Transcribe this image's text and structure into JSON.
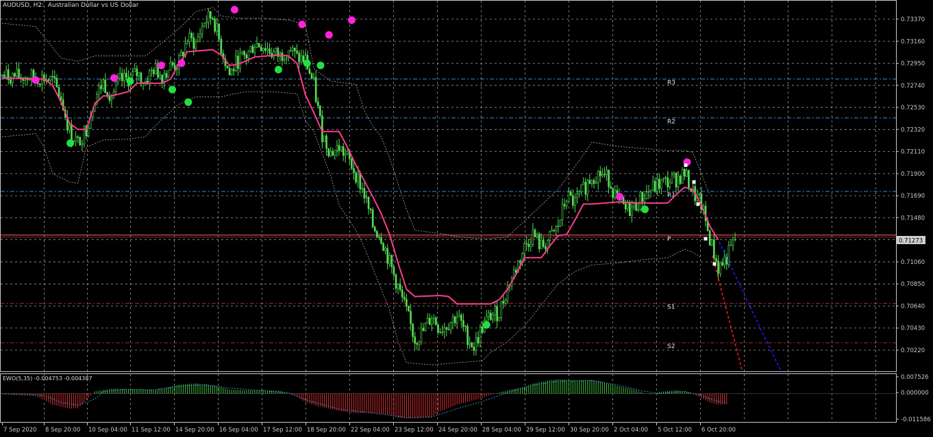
{
  "window": {
    "symbol": "AUDUSD",
    "timeframe": "H2",
    "description": "Australian Dollar vs US Dollar"
  },
  "price_tag": "0.71273",
  "colors": {
    "background": "#000000",
    "grid": "#d0d0d0",
    "candle": "#55e055",
    "mid_line": "#ff3c8c",
    "envelope": "#b0b0b0",
    "pivot_line": "#3a8fd8",
    "support_line": "#b02828",
    "pivot_p_line": "#ff6a6a",
    "upper_dot": "#ff22dd",
    "lower_dot": "#22e044",
    "forecast_red": "#ff2020",
    "forecast_blue": "#2020ff",
    "ewo_up": "#40c040",
    "ewo_down": "#d83030",
    "ewo_signal": "#3a8fd8"
  },
  "pivots": [
    {
      "label": "R3",
      "price": 0.728
    },
    {
      "label": "R2",
      "price": 0.7243
    },
    {
      "label": "R1",
      "price": 0.7173
    },
    {
      "label": "P",
      "price": 0.71315
    },
    {
      "label": "S1",
      "price": 0.70665
    },
    {
      "label": "S2",
      "price": 0.7029
    }
  ],
  "indicator": {
    "name": "EWO(5,35)",
    "value1": "-0.004753",
    "value2": "-0.004387",
    "y_ticks": [
      "0.007526",
      "0.000000",
      "-0.011586"
    ]
  },
  "chart_data": {
    "type": "candlestick",
    "symbol": "AUDUSD",
    "timeframe": "H2",
    "x_ticks": [
      "7 Sep 2020",
      "8 Sep 20:00",
      "10 Sep 04:00",
      "11 Sep 12:00",
      "14 Sep 20:00",
      "16 Sep 04:00",
      "17 Sep 12:00",
      "18 Sep 20:00",
      "22 Sep 04:00",
      "23 Sep 12:00",
      "24 Sep 20:00",
      "28 Sep 04:00",
      "29 Sep 12:00",
      "30 Sep 20:00",
      "2 Oct 04:00",
      "5 Oct 12:00",
      "6 Oct 20:00"
    ],
    "y_ticks": [
      "0.73370",
      "0.73160",
      "0.72950",
      "0.72740",
      "0.72530",
      "0.72320",
      "0.72110",
      "0.71900",
      "0.71690",
      "0.71480",
      "0.71273",
      "0.71060",
      "0.70850",
      "0.70640",
      "0.70430",
      "0.70220"
    ],
    "ylim": [
      0.701,
      0.735
    ],
    "close_path": [
      [
        0,
        0.7283
      ],
      [
        3,
        0.7282
      ],
      [
        5,
        0.7281
      ],
      [
        6,
        0.7278
      ],
      [
        7,
        0.7262
      ],
      [
        8,
        0.723
      ],
      [
        9,
        0.7219
      ],
      [
        10,
        0.7233
      ],
      [
        11,
        0.7262
      ],
      [
        12,
        0.7277
      ],
      [
        13,
        0.7264
      ],
      [
        14,
        0.7278
      ],
      [
        15,
        0.728
      ],
      [
        16,
        0.7285
      ],
      [
        17,
        0.7278
      ],
      [
        18,
        0.729
      ],
      [
        19,
        0.7284
      ],
      [
        20,
        0.7292
      ],
      [
        21,
        0.7295
      ],
      [
        22,
        0.7318
      ],
      [
        23,
        0.7314
      ],
      [
        24,
        0.7335
      ],
      [
        25,
        0.734
      ],
      [
        26,
        0.731
      ],
      [
        27,
        0.7284
      ],
      [
        28,
        0.7298
      ],
      [
        29,
        0.7302
      ],
      [
        30,
        0.7314
      ],
      [
        31,
        0.7312
      ],
      [
        32,
        0.7305
      ],
      [
        33,
        0.7302
      ],
      [
        34,
        0.731
      ],
      [
        35,
        0.73
      ],
      [
        36,
        0.7298
      ],
      [
        37,
        0.7274
      ],
      [
        38,
        0.7228
      ],
      [
        39,
        0.721
      ],
      [
        40,
        0.7215
      ],
      [
        41,
        0.7205
      ],
      [
        42,
        0.719
      ],
      [
        43,
        0.717
      ],
      [
        44,
        0.714
      ],
      [
        45,
        0.713
      ],
      [
        46,
        0.7105
      ],
      [
        47,
        0.7082
      ],
      [
        48,
        0.7058
      ],
      [
        49,
        0.7032
      ],
      [
        50,
        0.704
      ],
      [
        51,
        0.7055
      ],
      [
        52,
        0.7042
      ],
      [
        53,
        0.7048
      ],
      [
        54,
        0.7055
      ],
      [
        55,
        0.7038
      ],
      [
        56,
        0.7025
      ],
      [
        57,
        0.7044
      ],
      [
        58,
        0.7055
      ],
      [
        59,
        0.7058
      ],
      [
        60,
        0.7082
      ],
      [
        61,
        0.71
      ],
      [
        62,
        0.712
      ],
      [
        63,
        0.7133
      ],
      [
        64,
        0.712
      ],
      [
        65,
        0.7128
      ],
      [
        66,
        0.714
      ],
      [
        67,
        0.7168
      ],
      [
        68,
        0.7162
      ],
      [
        69,
        0.7175
      ],
      [
        70,
        0.7188
      ],
      [
        71,
        0.719
      ],
      [
        72,
        0.7185
      ],
      [
        73,
        0.7165
      ],
      [
        74,
        0.7155
      ],
      [
        75,
        0.7158
      ],
      [
        76,
        0.7168
      ],
      [
        77,
        0.7175
      ],
      [
        78,
        0.718
      ],
      [
        79,
        0.7182
      ],
      [
        80,
        0.7185
      ],
      [
        81,
        0.719
      ],
      [
        82,
        0.7172
      ],
      [
        83,
        0.716
      ],
      [
        84,
        0.7128
      ],
      [
        85,
        0.71
      ],
      [
        86,
        0.711
      ],
      [
        87,
        0.7127
      ]
    ],
    "mid_line": [
      [
        0,
        0.7281
      ],
      [
        5,
        0.728
      ],
      [
        6,
        0.7274
      ],
      [
        7,
        0.7258
      ],
      [
        8,
        0.7238
      ],
      [
        9,
        0.7232
      ],
      [
        10,
        0.7232
      ],
      [
        11,
        0.7256
      ],
      [
        12,
        0.7264
      ],
      [
        13,
        0.7264
      ],
      [
        15,
        0.7268
      ],
      [
        16,
        0.7276
      ],
      [
        18,
        0.7276
      ],
      [
        19,
        0.7276
      ],
      [
        20,
        0.728
      ],
      [
        21,
        0.7295
      ],
      [
        22,
        0.7306
      ],
      [
        25,
        0.7308
      ],
      [
        26,
        0.7303
      ],
      [
        27,
        0.7293
      ],
      [
        28,
        0.7294
      ],
      [
        30,
        0.7301
      ],
      [
        33,
        0.7303
      ],
      [
        34,
        0.7302
      ],
      [
        35,
        0.7295
      ],
      [
        36,
        0.7265
      ],
      [
        37,
        0.7248
      ],
      [
        38,
        0.723
      ],
      [
        40,
        0.723
      ],
      [
        41,
        0.7215
      ],
      [
        42,
        0.7198
      ],
      [
        43,
        0.7183
      ],
      [
        44,
        0.7168
      ],
      [
        45,
        0.7152
      ],
      [
        46,
        0.7132
      ],
      [
        47,
        0.7105
      ],
      [
        48,
        0.708
      ],
      [
        49,
        0.7073
      ],
      [
        52,
        0.7074
      ],
      [
        53,
        0.7073
      ],
      [
        54,
        0.7066
      ],
      [
        57,
        0.7066
      ],
      [
        58,
        0.7066
      ],
      [
        59,
        0.707
      ],
      [
        60,
        0.708
      ],
      [
        61,
        0.7094
      ],
      [
        62,
        0.711
      ],
      [
        63,
        0.711
      ],
      [
        64,
        0.711
      ],
      [
        65,
        0.7121
      ],
      [
        66,
        0.7131
      ],
      [
        67,
        0.7132
      ],
      [
        68,
        0.7146
      ],
      [
        69,
        0.7161
      ],
      [
        70,
        0.7161
      ],
      [
        73,
        0.7163
      ],
      [
        76,
        0.7162
      ],
      [
        79,
        0.7162
      ],
      [
        80,
        0.717
      ],
      [
        81,
        0.7177
      ],
      [
        82,
        0.7175
      ],
      [
        83,
        0.716
      ],
      [
        84,
        0.714
      ],
      [
        85,
        0.7127
      ]
    ],
    "envelope_upper": [
      [
        0,
        0.7333
      ],
      [
        4,
        0.733
      ],
      [
        5,
        0.732
      ],
      [
        7,
        0.73
      ],
      [
        9,
        0.7297
      ],
      [
        11,
        0.7302
      ],
      [
        14,
        0.7302
      ],
      [
        17,
        0.7302
      ],
      [
        18,
        0.7308
      ],
      [
        21,
        0.7328
      ],
      [
        23,
        0.7344
      ],
      [
        25,
        0.7348
      ],
      [
        26,
        0.734
      ],
      [
        28,
        0.7338
      ],
      [
        31,
        0.7338
      ],
      [
        34,
        0.7336
      ],
      [
        36,
        0.7332
      ],
      [
        37,
        0.729
      ],
      [
        39,
        0.7278
      ],
      [
        42,
        0.7275
      ],
      [
        43,
        0.725
      ],
      [
        44,
        0.7235
      ],
      [
        45,
        0.7225
      ],
      [
        46,
        0.7205
      ],
      [
        47,
        0.718
      ],
      [
        48,
        0.7156
      ],
      [
        49,
        0.7136
      ],
      [
        52,
        0.7133
      ],
      [
        54,
        0.713
      ],
      [
        57,
        0.7128
      ],
      [
        58,
        0.7128
      ],
      [
        60,
        0.713
      ],
      [
        62,
        0.7145
      ],
      [
        64,
        0.716
      ],
      [
        66,
        0.7175
      ],
      [
        67,
        0.7186
      ],
      [
        69,
        0.7208
      ],
      [
        70,
        0.722
      ],
      [
        73,
        0.7216
      ],
      [
        76,
        0.7214
      ],
      [
        79,
        0.7212
      ],
      [
        81,
        0.7212
      ],
      [
        82,
        0.721
      ],
      [
        83,
        0.719
      ],
      [
        84,
        0.717
      ]
    ],
    "envelope_lower": [
      [
        0,
        0.7225
      ],
      [
        4,
        0.7228
      ],
      [
        5,
        0.7215
      ],
      [
        6,
        0.719
      ],
      [
        8,
        0.7182
      ],
      [
        9,
        0.7181
      ],
      [
        10,
        0.7215
      ],
      [
        12,
        0.7222
      ],
      [
        15,
        0.7223
      ],
      [
        17,
        0.7225
      ],
      [
        18,
        0.7234
      ],
      [
        19,
        0.7242
      ],
      [
        21,
        0.7256
      ],
      [
        23,
        0.7263
      ],
      [
        26,
        0.7263
      ],
      [
        27,
        0.7265
      ],
      [
        29,
        0.7268
      ],
      [
        32,
        0.7268
      ],
      [
        35,
        0.7266
      ],
      [
        36,
        0.724
      ],
      [
        37,
        0.723
      ],
      [
        39,
        0.7188
      ],
      [
        40,
        0.716
      ],
      [
        42,
        0.7136
      ],
      [
        43,
        0.712
      ],
      [
        44,
        0.71
      ],
      [
        45,
        0.708
      ],
      [
        46,
        0.706
      ],
      [
        47,
        0.703
      ],
      [
        48,
        0.701
      ],
      [
        51,
        0.7008
      ],
      [
        54,
        0.701
      ],
      [
        57,
        0.7012
      ],
      [
        58,
        0.702
      ],
      [
        60,
        0.703
      ],
      [
        62,
        0.7045
      ],
      [
        64,
        0.7065
      ],
      [
        66,
        0.7085
      ],
      [
        68,
        0.7097
      ],
      [
        70,
        0.7103
      ],
      [
        73,
        0.7105
      ],
      [
        76,
        0.7108
      ],
      [
        79,
        0.711
      ],
      [
        81,
        0.7118
      ],
      [
        82,
        0.7115
      ],
      [
        83,
        0.711
      ]
    ],
    "upper_dots": [
      [
        1,
        0.7279
      ],
      [
        5,
        0.728
      ],
      [
        6,
        0.7279
      ],
      [
        9,
        0.7292
      ],
      [
        10,
        0.7294
      ],
      [
        11,
        0.7341
      ],
      [
        12,
        0.732
      ],
      [
        13,
        0.7311
      ],
      [
        14,
        0.7328
      ],
      [
        22,
        0.7168
      ],
      [
        26,
        0.7204
      ]
    ],
    "lower_dots": [
      [
        3,
        0.7218
      ],
      [
        4,
        0.728
      ],
      [
        6,
        0.727
      ],
      [
        7,
        0.726
      ],
      [
        8,
        0.7289
      ],
      [
        9,
        0.7294
      ],
      [
        10,
        0.7292
      ],
      [
        18,
        0.7046
      ],
      [
        23,
        0.7159
      ]
    ],
    "forecast_red": [
      [
        84,
        0.7113
      ],
      [
        88,
        0.7005
      ]
    ],
    "forecast_blue": [
      [
        85,
        0.7125
      ],
      [
        91,
        0.7005
      ]
    ],
    "ewo": [
      [
        0,
        -0.0002
      ],
      [
        4,
        -0.001
      ],
      [
        6,
        -0.005
      ],
      [
        8,
        -0.0068
      ],
      [
        9,
        -0.0066
      ],
      [
        10,
        -0.003
      ],
      [
        11,
        0.001
      ],
      [
        13,
        0.0022
      ],
      [
        16,
        0.002
      ],
      [
        18,
        0.0018
      ],
      [
        19,
        0.0023
      ],
      [
        21,
        0.004
      ],
      [
        23,
        0.0046
      ],
      [
        25,
        0.0038
      ],
      [
        27,
        0.0018
      ],
      [
        29,
        0.0015
      ],
      [
        31,
        0.0016
      ],
      [
        33,
        0.0012
      ],
      [
        35,
        -0.0012
      ],
      [
        36,
        -0.004
      ],
      [
        38,
        -0.0062
      ],
      [
        40,
        -0.0078
      ],
      [
        42,
        -0.0089
      ],
      [
        44,
        -0.0088
      ],
      [
        46,
        -0.0095
      ],
      [
        47,
        -0.011
      ],
      [
        48,
        -0.0112
      ],
      [
        49,
        -0.0112
      ],
      [
        51,
        -0.0105
      ],
      [
        52,
        -0.008
      ],
      [
        54,
        -0.005
      ],
      [
        55,
        -0.004
      ],
      [
        57,
        -0.002
      ],
      [
        58,
        -0.0006
      ],
      [
        60,
        0.0015
      ],
      [
        62,
        0.003
      ],
      [
        63,
        0.0045
      ],
      [
        65,
        0.006
      ],
      [
        66,
        0.0065
      ],
      [
        68,
        0.006
      ],
      [
        70,
        0.0062
      ],
      [
        71,
        0.0055
      ],
      [
        73,
        0.0035
      ],
      [
        75,
        0.0018
      ],
      [
        76,
        0.0005
      ],
      [
        77,
        -0.0006
      ],
      [
        78,
        0.0008
      ],
      [
        80,
        0.0015
      ],
      [
        81,
        0.001
      ],
      [
        82,
        0.0002
      ],
      [
        83,
        -0.002
      ],
      [
        84,
        -0.004
      ],
      [
        85,
        -0.005
      ],
      [
        86,
        -0.0048
      ]
    ],
    "ewo_signal": [
      [
        0,
        -0.0001
      ],
      [
        5,
        -0.0008
      ],
      [
        7,
        -0.004
      ],
      [
        9,
        -0.0052
      ],
      [
        11,
        -0.0025
      ],
      [
        12,
        0.0008
      ],
      [
        14,
        0.0018
      ],
      [
        18,
        0.0017
      ],
      [
        21,
        0.0033
      ],
      [
        24,
        0.004
      ],
      [
        27,
        0.0025
      ],
      [
        30,
        0.0016
      ],
      [
        34,
        0.0004
      ],
      [
        36,
        -0.0028
      ],
      [
        40,
        -0.007
      ],
      [
        44,
        -0.0088
      ],
      [
        48,
        -0.0108
      ],
      [
        51,
        -0.0106
      ],
      [
        54,
        -0.0068
      ],
      [
        57,
        -0.0035
      ],
      [
        60,
        0.0005
      ],
      [
        63,
        0.0038
      ],
      [
        66,
        0.0056
      ],
      [
        70,
        0.0058
      ],
      [
        73,
        0.004
      ],
      [
        76,
        0.0012
      ],
      [
        78,
        0.0
      ],
      [
        81,
        0.001
      ],
      [
        83,
        -0.001
      ],
      [
        85,
        -0.0035
      ],
      [
        86,
        -0.0042
      ]
    ],
    "ewo_ylim": [
      -0.0125,
      0.0085
    ]
  }
}
